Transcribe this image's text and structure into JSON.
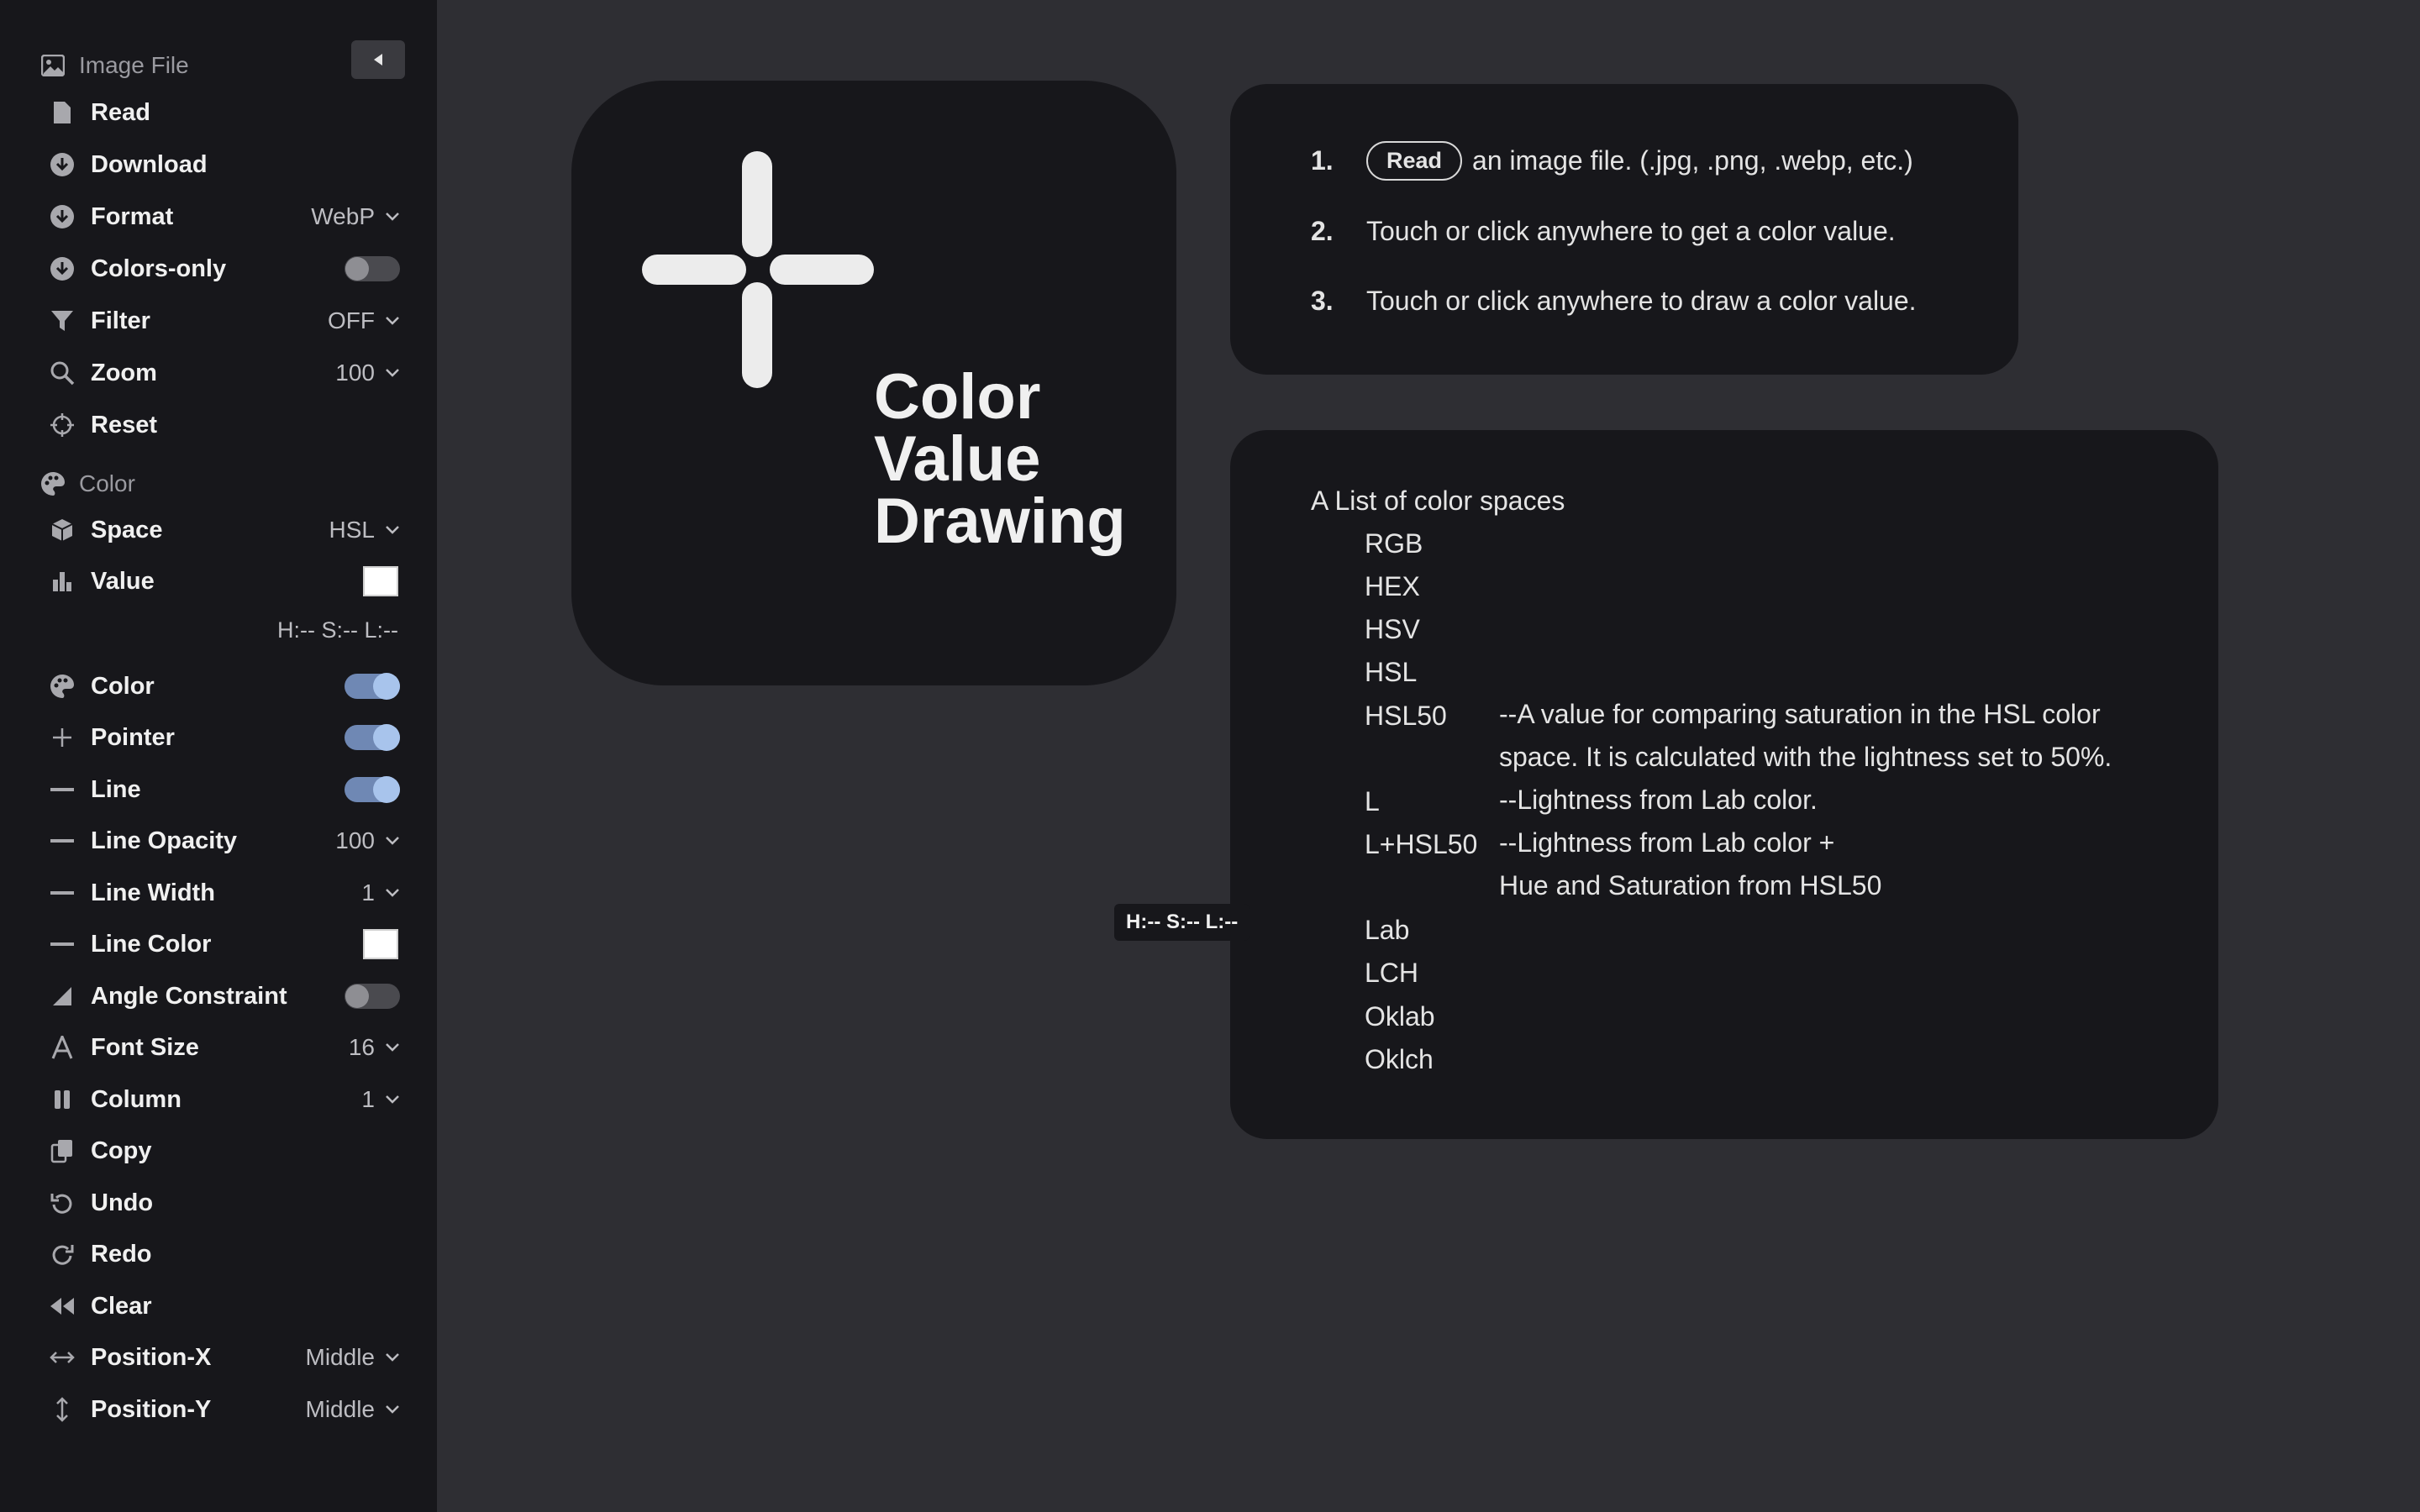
{
  "sidebar": {
    "image_section": "Image File",
    "color_section": "Color",
    "items": {
      "read": {
        "label": "Read"
      },
      "download": {
        "label": "Download"
      },
      "format": {
        "label": "Format",
        "value": "WebP"
      },
      "colors_only": {
        "label": "Colors-only",
        "on": false
      },
      "filter": {
        "label": "Filter",
        "value": "OFF"
      },
      "zoom": {
        "label": "Zoom",
        "value": "100"
      },
      "reset": {
        "label": "Reset"
      },
      "space": {
        "label": "Space",
        "value": "HSL"
      },
      "value": {
        "label": "Value",
        "swatch_color": "#ffffff"
      },
      "readout": "H:-- S:-- L:--",
      "color": {
        "label": "Color",
        "on": true
      },
      "pointer": {
        "label": "Pointer",
        "on": true
      },
      "line": {
        "label": "Line",
        "on": true
      },
      "line_opacity": {
        "label": "Line Opacity",
        "value": "100"
      },
      "line_width": {
        "label": "Line Width",
        "value": "1"
      },
      "line_color": {
        "label": "Line Color",
        "swatch_color": "#ffffff"
      },
      "angle_constraint": {
        "label": "Angle Constraint",
        "on": false
      },
      "font_size": {
        "label": "Font Size",
        "value": "16"
      },
      "column": {
        "label": "Column",
        "value": "1"
      },
      "copy": {
        "label": "Copy"
      },
      "undo": {
        "label": "Undo"
      },
      "redo": {
        "label": "Redo"
      },
      "clear": {
        "label": "Clear"
      },
      "position_x": {
        "label": "Position-X",
        "value": "Middle"
      },
      "position_y": {
        "label": "Position-Y",
        "value": "Middle"
      }
    }
  },
  "logo": {
    "line1": "Color",
    "line2": "Value",
    "line3": "Drawing"
  },
  "steps": [
    {
      "num": "1.",
      "button": "Read",
      "text": "an image file. (.jpg, .png, .webp, etc.)"
    },
    {
      "num": "2.",
      "text": "Touch or click anywhere to get a color value."
    },
    {
      "num": "3.",
      "text": "Touch or click anywhere to draw a color value."
    }
  ],
  "color_spaces": {
    "title": "A List of color spaces",
    "items": [
      "RGB",
      "HEX",
      "HSV",
      "HSL",
      "HSL50",
      "L",
      "L+HSL50",
      "Lab",
      "LCH",
      "Oklab",
      "Oklch"
    ],
    "hsl50_desc": "--A value for comparing saturation in the HSL color space. It is calculated with the lightness set to 50%.",
    "l_desc": "--Lightness from Lab color.",
    "lhsl50_desc_1": "--Lightness from Lab color +",
    "lhsl50_desc_2": "Hue and Saturation from HSL50"
  },
  "floating_readout": "H:-- S:-- L:--",
  "colors": {
    "sidebar_bg": "#17171b",
    "main_bg": "#2e2e33",
    "toggle_on": "#6f88b4"
  }
}
